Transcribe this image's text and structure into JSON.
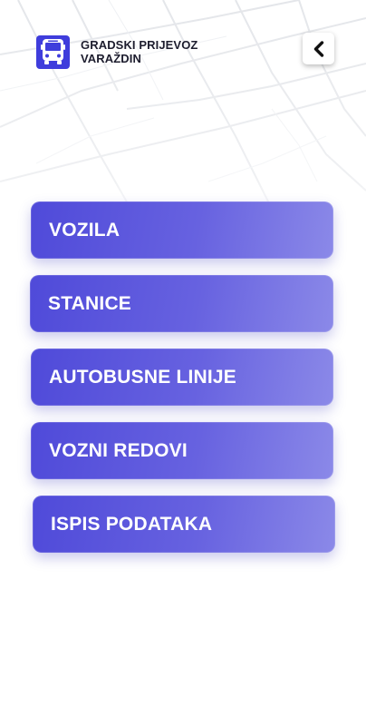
{
  "header": {
    "title_line1": "GRADSKI PRIJEVOZ",
    "title_line2": "VARAŽDIN",
    "logo_icon": "bus-icon",
    "back_icon": "chevron-left-icon"
  },
  "menu": {
    "items": [
      {
        "label": "VOZILA"
      },
      {
        "label": "STANICE"
      },
      {
        "label": "AUTOBUSNE LINIJE"
      },
      {
        "label": "VOZNI REDOVI"
      },
      {
        "label": "ISPIS PODATAKA"
      }
    ]
  },
  "colors": {
    "accent": "#3f3ddc",
    "button_gradient_start": "#4f4ad9",
    "button_gradient_end": "#8b89e8"
  }
}
